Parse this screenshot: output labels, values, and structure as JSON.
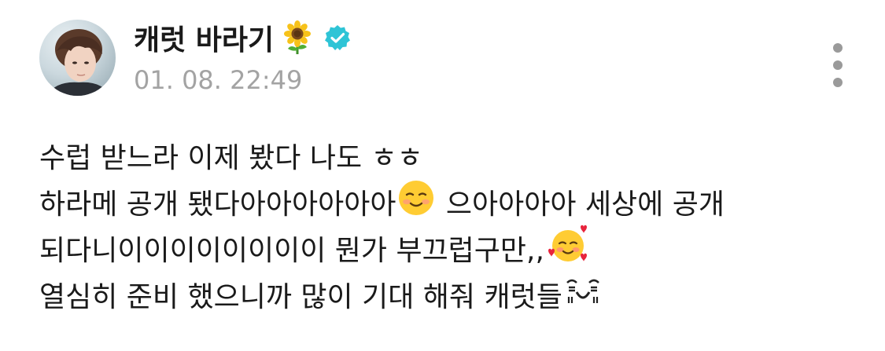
{
  "post": {
    "author": {
      "username": "캐럿 바라기",
      "name_emoji": "sunflower-icon",
      "verified_icon": "verified-badge-icon",
      "verified_color": "#2ec4d6"
    },
    "timestamp": "01. 08. 22:49",
    "menu_icon": "more-vertical-icon",
    "lines": [
      {
        "text_a": "수럽 받느라 이제 봤다 나도 ㅎㅎ"
      },
      {
        "text_a": "하라메 공개 됐다아아아아아아",
        "emoji_name": "smiling-face-icon",
        "text_b": " 으아아아아 세상에 공개"
      },
      {
        "text_a": "되다니이이이이이이이이 뭔가 부끄럽구만,,",
        "emoji_name": "smiling-face-with-hearts-icon"
      },
      {
        "text_a": "열심히 준비 했으니까 많이 기대 해줘 캐럿들",
        "emoji_name": "kaomoji-icon"
      }
    ]
  }
}
